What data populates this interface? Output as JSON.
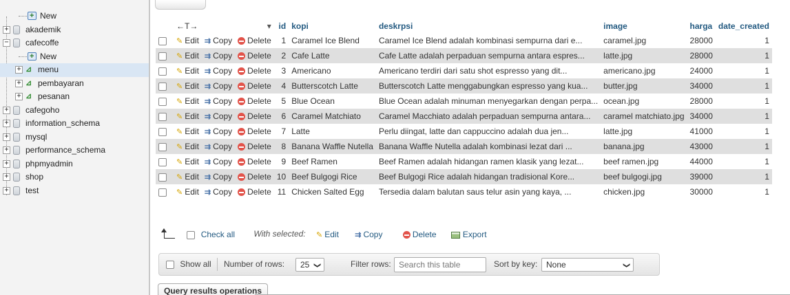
{
  "sidebar": {
    "items": [
      {
        "label": "New",
        "level": 1,
        "kind": "new"
      },
      {
        "label": "akademik",
        "level": 0,
        "kind": "db"
      },
      {
        "label": "cafecoffe",
        "level": 0,
        "kind": "db"
      },
      {
        "label": "New",
        "level": 1,
        "kind": "new"
      },
      {
        "label": "menu",
        "level": 1,
        "kind": "table"
      },
      {
        "label": "pembayaran",
        "level": 1,
        "kind": "table"
      },
      {
        "label": "pesanan",
        "level": 1,
        "kind": "table"
      },
      {
        "label": "cafegoho",
        "level": 0,
        "kind": "db"
      },
      {
        "label": "information_schema",
        "level": 0,
        "kind": "db"
      },
      {
        "label": "mysql",
        "level": 0,
        "kind": "db"
      },
      {
        "label": "performance_schema",
        "level": 0,
        "kind": "db"
      },
      {
        "label": "phpmyadmin",
        "level": 0,
        "kind": "db"
      },
      {
        "label": "shop",
        "level": 0,
        "kind": "db"
      },
      {
        "label": "test",
        "level": 0,
        "kind": "db"
      }
    ],
    "expand_symbol": "+",
    "collapse_symbol": "−"
  },
  "table": {
    "nav_arrows": "←T→",
    "sort_arrow": "▾",
    "columns": [
      "id",
      "kopi",
      "deskrpsi",
      "image",
      "harga",
      "date_created"
    ],
    "actions": {
      "edit": "Edit",
      "copy": "Copy",
      "delete": "Delete"
    },
    "rows": [
      {
        "id": "1",
        "kopi": "Caramel Ice Blend",
        "deskrpsi": "Caramel Ice Blend adalah kombinasi sempurna dari e...",
        "image": "caramel.jpg",
        "harga": "28000",
        "date_created": "1"
      },
      {
        "id": "2",
        "kopi": "Cafe Latte",
        "deskrpsi": "Cafe Latte adalah perpaduan sempurna antara espres...",
        "image": "latte.jpg",
        "harga": "28000",
        "date_created": "1"
      },
      {
        "id": "3",
        "kopi": "Americano",
        "deskrpsi": "Americano terdiri dari satu shot espresso yang dit...",
        "image": "americano.jpg",
        "harga": "24000",
        "date_created": "1"
      },
      {
        "id": "4",
        "kopi": "Butterscotch Latte",
        "deskrpsi": "Butterscotch Latte menggabungkan espresso yang kua...",
        "image": "butter.jpg",
        "harga": "34000",
        "date_created": "1"
      },
      {
        "id": "5",
        "kopi": "Blue Ocean",
        "deskrpsi": "Blue Ocean adalah minuman menyegarkan dengan perpa...",
        "image": "ocean.jpg",
        "harga": "28000",
        "date_created": "1"
      },
      {
        "id": "6",
        "kopi": "Caramel Matchiato",
        "deskrpsi": "Caramel Macchiato adalah perpaduan sempurna antara...",
        "image": "caramel matchiato.jpg",
        "harga": "34000",
        "date_created": "1"
      },
      {
        "id": "7",
        "kopi": "Latte",
        "deskrpsi": "Perlu diingat, latte dan cappuccino adalah dua jen...",
        "image": "latte.jpg",
        "harga": "41000",
        "date_created": "1"
      },
      {
        "id": "8",
        "kopi": "Banana Waffle Nutella",
        "deskrpsi": "Banana Waffle Nutella adalah kombinasi lezat dari ...",
        "image": "banana.jpg",
        "harga": "43000",
        "date_created": "1"
      },
      {
        "id": "9",
        "kopi": "Beef Ramen",
        "deskrpsi": "Beef Ramen adalah hidangan ramen klasik yang lezat...",
        "image": "beef ramen.jpg",
        "harga": "44000",
        "date_created": "1"
      },
      {
        "id": "10",
        "kopi": "Beef Bulgogi Rice",
        "deskrpsi": "Beef Bulgogi Rice adalah hidangan tradisional Kore...",
        "image": "beef bulgogi.jpg",
        "harga": "39000",
        "date_created": "1"
      },
      {
        "id": "11",
        "kopi": "Chicken Salted Egg",
        "deskrpsi": "Tersedia dalam balutan saus telur asin yang kaya, ...",
        "image": "chicken.jpg",
        "harga": "30000",
        "date_created": "1"
      }
    ]
  },
  "bulk": {
    "check_all": "Check all",
    "with_selected": "With selected:",
    "edit": "Edit",
    "copy": "Copy",
    "delete": "Delete",
    "export": "Export"
  },
  "navbar": {
    "show_all": "Show all",
    "number_of_rows_label": "Number of rows:",
    "number_of_rows_value": "25",
    "filter_rows_label": "Filter rows:",
    "filter_placeholder": "Search this table",
    "sort_by_key_label": "Sort by key:",
    "sort_by_key_value": "None",
    "chevron": "❯"
  },
  "query_results_tab": "Query results operations",
  "colors": {
    "link_blue": "#235a81",
    "row_even": "#dfdfdf",
    "sidebar_bg": "#f3f3f3"
  }
}
